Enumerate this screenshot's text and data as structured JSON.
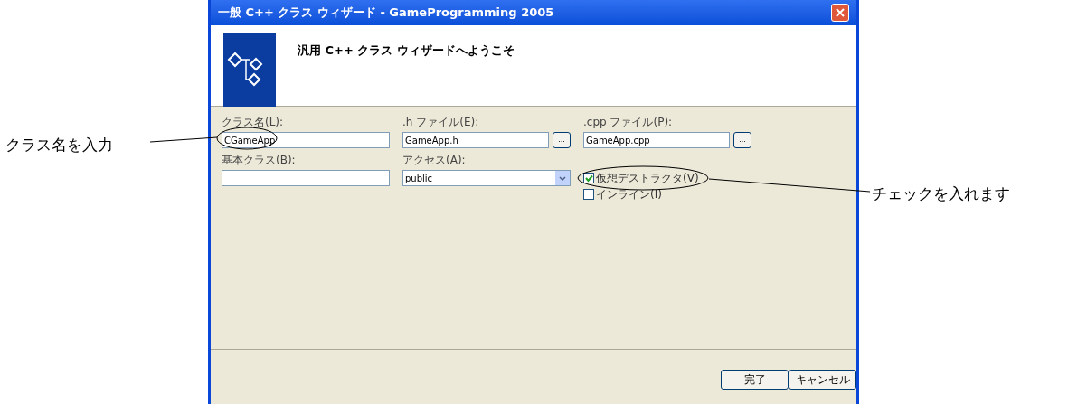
{
  "window": {
    "title": "一般 C++ クラス ウィザード - GameProgramming 2005"
  },
  "header": {
    "text": "汎用 C++ クラス ウィザードへようこそ"
  },
  "fields": [
    {
      "kind": "text",
      "label": "クラス名(L):",
      "value": "CGameApp"
    },
    {
      "kind": "browse",
      "label": ".h ファイル(E):",
      "value": "GameApp.h",
      "button": "..."
    },
    {
      "kind": "browse",
      "label": ".cpp ファイル(P):",
      "value": "GameApp.cpp",
      "button": "..."
    },
    {
      "kind": "text",
      "label": "基本クラス(B):"
    },
    {
      "kind": "dropdown",
      "label": "アクセス(A):",
      "value": "public"
    },
    {
      "kind": "checks"
    }
  ],
  "checkboxes": [
    {
      "label": "仮想デストラクタ(V)",
      "checked": true
    },
    {
      "label": "インライン(I)",
      "checked": false
    }
  ],
  "buttons": [
    {
      "label": "完了"
    },
    {
      "label": "キャンセル"
    }
  ],
  "annotations": [
    {
      "text": "クラス名を入力"
    },
    {
      "text": "チェックを入れます"
    }
  ]
}
